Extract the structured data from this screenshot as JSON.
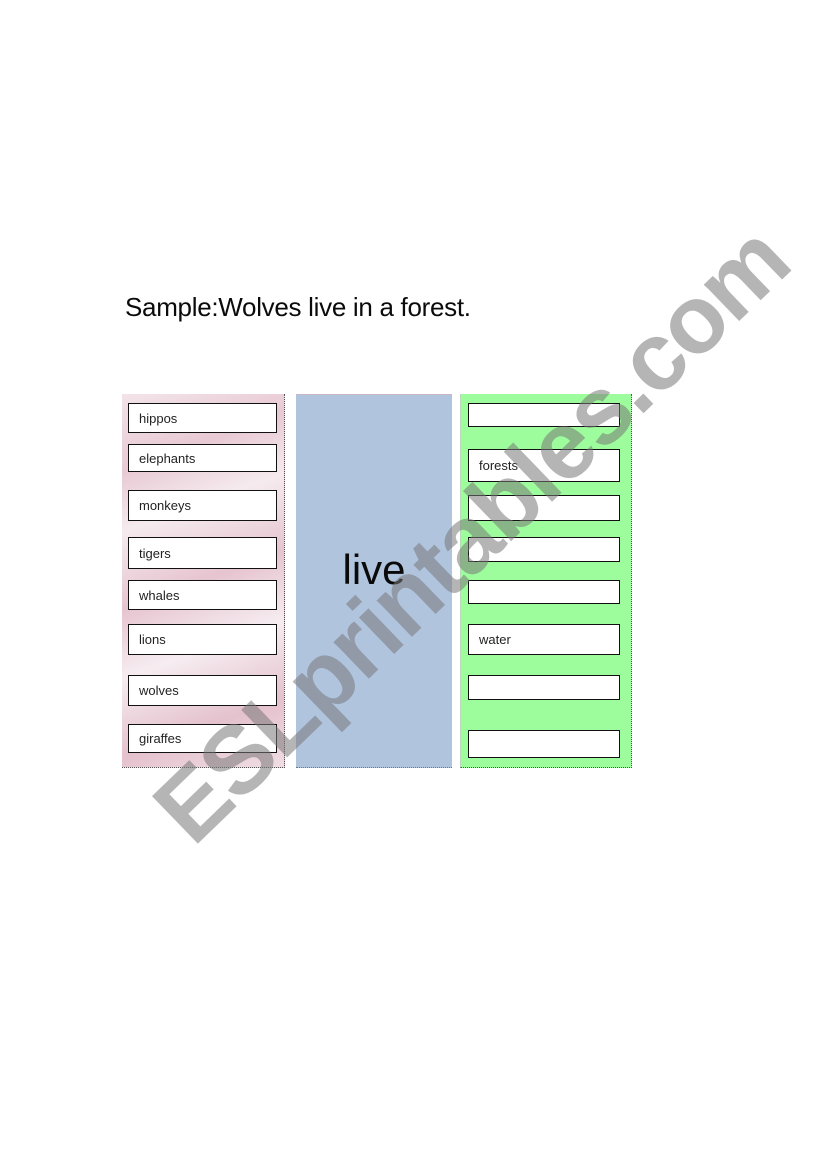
{
  "title": "Sample:Wolves live in a forest.",
  "verb": "live",
  "colors": {
    "left_panel": "#ecd2dc",
    "middle_panel": "#b0c4de",
    "right_panel": "#9dfc9c"
  },
  "subjects": [
    "hippos",
    "elephants",
    "monkeys",
    "tigers",
    "whales",
    "lions",
    "wolves",
    "giraffes"
  ],
  "places": [
    "",
    "forests",
    "",
    "",
    "",
    "water",
    "",
    ""
  ],
  "watermark": "ESLprintables.com"
}
